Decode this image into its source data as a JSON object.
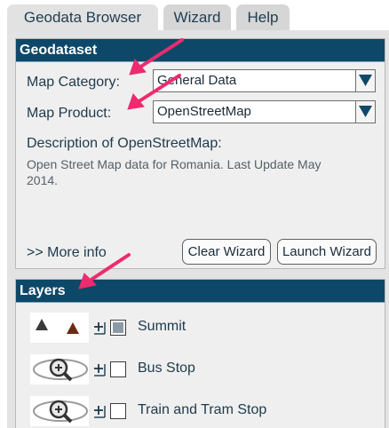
{
  "tabs": [
    {
      "label": "Geodata Browser",
      "active": true
    },
    {
      "label": "Wizard",
      "active": false
    },
    {
      "label": "Help",
      "active": false
    }
  ],
  "geodataset": {
    "title": "Geodataset",
    "category_label": "Map Category:",
    "category_value": "General Data",
    "product_label": "Map Product:",
    "product_value": "OpenStreetMap",
    "description_title": "Description of OpenStreetMap:",
    "description_text": "Open Street Map data for Romania. Last Update May 2014.",
    "more_info": ">> More info",
    "clear_button": "Clear Wizard",
    "launch_button": "Launch Wizard"
  },
  "layers": {
    "title": "Layers",
    "items": [
      {
        "label": "Summit",
        "icon": "summit-triangles-icon",
        "checked": "partial"
      },
      {
        "label": "Bus Stop",
        "icon": "magnifier-eye-icon",
        "checked": "unchecked"
      },
      {
        "label": "Train and Tram Stop",
        "icon": "magnifier-eye-icon",
        "checked": "unchecked"
      }
    ]
  },
  "colors": {
    "header_bg": "#0e4868",
    "annotation_arrow": "#ee2b6e",
    "panel_bg": "#efefef"
  }
}
